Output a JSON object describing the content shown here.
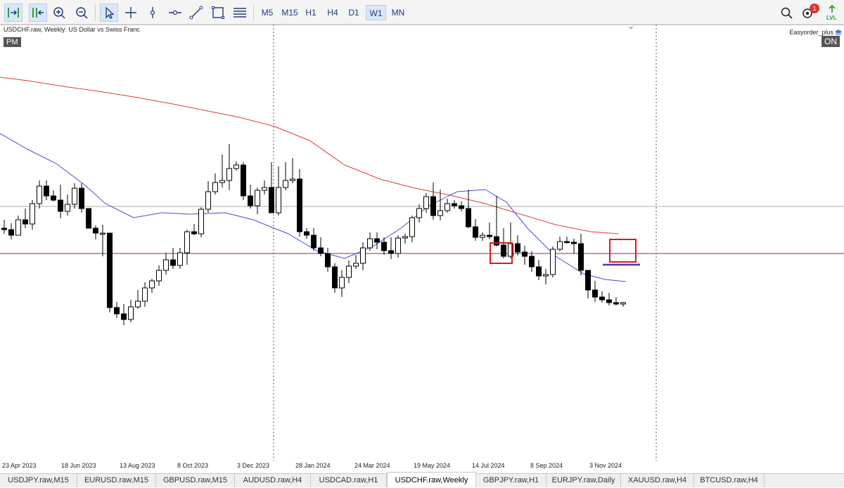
{
  "toolbar": {
    "tools": [
      {
        "name": "chart-autoscroll",
        "icon": "autoscroll-icon"
      },
      {
        "name": "chart-shift",
        "icon": "chart-shift-icon"
      },
      {
        "name": "zoom-in",
        "icon": "zoom-in-icon"
      },
      {
        "name": "zoom-out",
        "icon": "zoom-out-icon"
      },
      {
        "name": "cursor",
        "icon": "cursor-icon"
      },
      {
        "name": "crosshair",
        "icon": "crosshair-icon"
      },
      {
        "name": "vertical-line",
        "icon": "vertical-line-icon"
      },
      {
        "name": "horizontal-line",
        "icon": "horizontal-line-icon"
      },
      {
        "name": "trendline",
        "icon": "trendline-icon"
      },
      {
        "name": "rectangle",
        "icon": "rectangle-icon"
      },
      {
        "name": "fibonacci",
        "icon": "fibonacci-icon"
      }
    ],
    "timeframes": [
      "M5",
      "M15",
      "H1",
      "H4",
      "D1",
      "W1",
      "MN"
    ],
    "active_timeframe": "W1",
    "notification_count": "1",
    "colors": {
      "accent": "#1f6fd1",
      "active_bg": "#d9e6f7",
      "green": "#2e9b3a"
    }
  },
  "chart": {
    "title": "USDCHF.raw, Weekly:  US Dollar vs Swiss Franc",
    "pm_badge": "PM",
    "ea_name": "Easyorder_plus",
    "ea_status": "ON",
    "x_labels": [
      "23 Apr 2023",
      "18 Jun 2023",
      "13 Aug 2023",
      "8 Oct 2023",
      "3 Dec 2023",
      "28 Jan 2024",
      "24 Mar 2024",
      "19 May 2024",
      "14 Jul 2024",
      "8 Sep 2024",
      "3 Nov 2024"
    ],
    "colors": {
      "red_ma": "#e03a3a",
      "blue_ma": "#4a4ad8",
      "level_line": "#8a2a6a",
      "support_line": "#5b2bd0",
      "box": "#e01818",
      "candle": "#000000"
    }
  },
  "chart_data": {
    "type": "candlestick",
    "symbol": "USDCHF.raw",
    "timeframe": "Weekly",
    "candles": [
      [
        290,
        298,
        278,
        292
      ],
      [
        292,
        306,
        283,
        300
      ],
      [
        300,
        300,
        272,
        278
      ],
      [
        278,
        290,
        262,
        284
      ],
      [
        284,
        292,
        250,
        255
      ],
      [
        255,
        262,
        222,
        230
      ],
      [
        230,
        250,
        222,
        244
      ],
      [
        244,
        252,
        236,
        250
      ],
      [
        250,
        276,
        228,
        266
      ],
      [
        266,
        272,
        242,
        256
      ],
      [
        256,
        262,
        226,
        233
      ],
      [
        233,
        268,
        226,
        262
      ],
      [
        262,
        268,
        288,
        290
      ],
      [
        290,
        306,
        286,
        297
      ],
      [
        297,
        330,
        285,
        297
      ],
      [
        297,
        360,
        410,
        403
      ],
      [
        403,
        418,
        395,
        412
      ],
      [
        412,
        428,
        398,
        420
      ],
      [
        420,
        424,
        392,
        402
      ],
      [
        402,
        405,
        378,
        394
      ],
      [
        394,
        402,
        367,
        375
      ],
      [
        375,
        382,
        362,
        365
      ],
      [
        365,
        372,
        343,
        350
      ],
      [
        350,
        356,
        325,
        335
      ],
      [
        335,
        348,
        318,
        343
      ],
      [
        343,
        348,
        318,
        325
      ],
      [
        325,
        342,
        292,
        295
      ],
      [
        295,
        300,
        284,
        298
      ],
      [
        298,
        303,
        260,
        263
      ],
      [
        263,
        268,
        223,
        238
      ],
      [
        238,
        242,
        212,
        225
      ],
      [
        225,
        232,
        185,
        222
      ],
      [
        222,
        236,
        170,
        205
      ],
      [
        205,
        208,
        195,
        200
      ],
      [
        200,
        250,
        196,
        244
      ],
      [
        244,
        262,
        228,
        258
      ],
      [
        258,
        270,
        232,
        236
      ],
      [
        236,
        242,
        222,
        232
      ],
      [
        232,
        245,
        196,
        268
      ],
      [
        268,
        272,
        202,
        232
      ],
      [
        232,
        236,
        196,
        222
      ],
      [
        222,
        226,
        190,
        220
      ],
      [
        220,
        302,
        206,
        295
      ],
      [
        295,
        305,
        290,
        300
      ],
      [
        300,
        322,
        290,
        318
      ],
      [
        318,
        330,
        303,
        326
      ],
      [
        326,
        352,
        318,
        345
      ],
      [
        345,
        382,
        340,
        375
      ],
      [
        375,
        388,
        350,
        360
      ],
      [
        360,
        368,
        336,
        344
      ],
      [
        344,
        348,
        328,
        340
      ],
      [
        340,
        350,
        310,
        318
      ],
      [
        318,
        322,
        296,
        305
      ],
      [
        305,
        320,
        296,
        310
      ],
      [
        310,
        328,
        303,
        322
      ],
      [
        322,
        334,
        303,
        326
      ],
      [
        326,
        332,
        300,
        304
      ],
      [
        304,
        312,
        298,
        302
      ],
      [
        302,
        310,
        272,
        275
      ],
      [
        275,
        282,
        256,
        262
      ],
      [
        262,
        268,
        240,
        245
      ],
      [
        245,
        278,
        225,
        272
      ],
      [
        272,
        279,
        235,
        265
      ],
      [
        265,
        268,
        248,
        255
      ],
      [
        255,
        262,
        250,
        258
      ],
      [
        258,
        266,
        252,
        262
      ],
      [
        262,
        290,
        235,
        288
      ],
      [
        288,
        308,
        277,
        303
      ],
      [
        303,
        308,
        296,
        300
      ],
      [
        300,
        306,
        282,
        302
      ],
      [
        302,
        316,
        244,
        314
      ],
      [
        314,
        333,
        290,
        330
      ],
      [
        330,
        333,
        282,
        312
      ],
      [
        312,
        329,
        300,
        324
      ],
      [
        324,
        342,
        315,
        330
      ],
      [
        330,
        352,
        323,
        345
      ],
      [
        345,
        364,
        335,
        358
      ],
      [
        358,
        370,
        348,
        356
      ],
      [
        356,
        360,
        316,
        320
      ],
      [
        320,
        323,
        302,
        309
      ],
      [
        309,
        312,
        302,
        310
      ],
      [
        310,
        326,
        305,
        312
      ],
      [
        312,
        357,
        298,
        350
      ],
      [
        350,
        390,
        355,
        378
      ],
      [
        378,
        395,
        365,
        388
      ],
      [
        388,
        396,
        380,
        392
      ],
      [
        392,
        400,
        382,
        396
      ],
      [
        396,
        400,
        388,
        398
      ],
      [
        398,
        402,
        395,
        396
      ]
    ],
    "moving_averages": [
      {
        "color": "#e03a3a",
        "label": ""
      },
      {
        "color": "#4a4ad8",
        "label": ""
      }
    ],
    "x_labels": [
      "23 Apr 2023",
      "18 Jun 2023",
      "13 Aug 2023",
      "8 Oct 2023",
      "3 Dec 2023",
      "28 Jan 2024",
      "24 Mar 2024",
      "19 May 2024",
      "14 Jul 2024",
      "8 Sep 2024",
      "3 Nov 2024"
    ]
  },
  "tabs": [
    {
      "label": "USDJPY.raw,M15",
      "active": false
    },
    {
      "label": "EURUSD.raw,M15",
      "active": false
    },
    {
      "label": "GBPUSD.raw,M15",
      "active": false
    },
    {
      "label": "AUDUSD.raw,H4",
      "active": false
    },
    {
      "label": "USDCAD.raw,H1",
      "active": false
    },
    {
      "label": "USDCHF.raw,Weekly",
      "active": true
    },
    {
      "label": "GBPJPY.raw,H1",
      "active": false
    },
    {
      "label": "EURJPY.raw,Daily",
      "active": false
    },
    {
      "label": "XAUUSD.raw,H4",
      "active": false
    },
    {
      "label": "BTCUSD.raw,H4",
      "active": false
    }
  ]
}
